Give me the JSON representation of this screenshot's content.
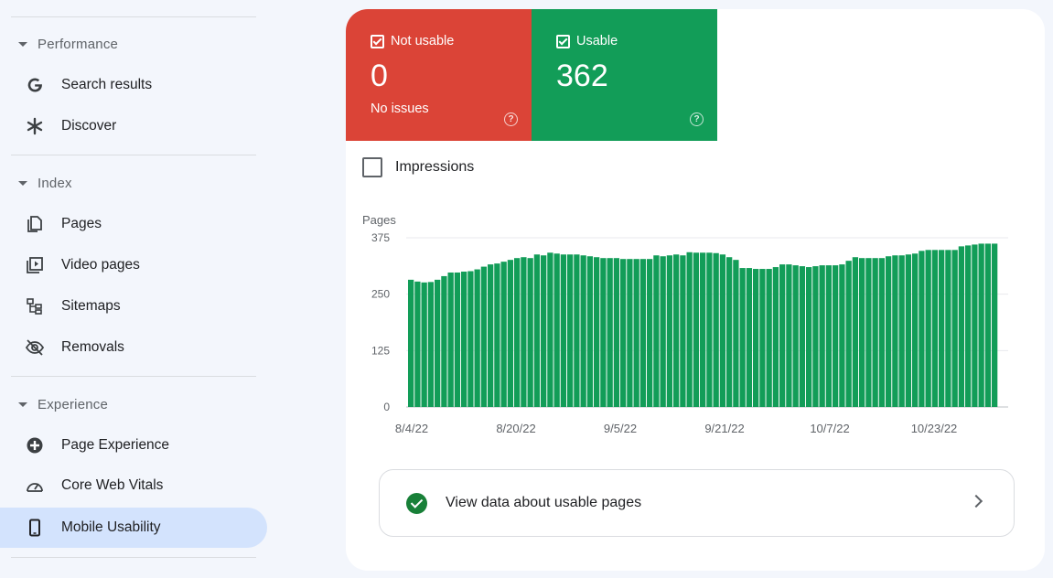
{
  "sidebar": {
    "sections": [
      {
        "title": "Performance",
        "items": [
          {
            "label": "Search results",
            "icon": "google-g-icon"
          },
          {
            "label": "Discover",
            "icon": "asterisk-icon"
          }
        ]
      },
      {
        "title": "Index",
        "items": [
          {
            "label": "Pages",
            "icon": "pages-icon"
          },
          {
            "label": "Video pages",
            "icon": "video-pages-icon"
          },
          {
            "label": "Sitemaps",
            "icon": "sitemap-icon"
          },
          {
            "label": "Removals",
            "icon": "eye-off-icon"
          }
        ]
      },
      {
        "title": "Experience",
        "items": [
          {
            "label": "Page Experience",
            "icon": "page-experience-icon"
          },
          {
            "label": "Core Web Vitals",
            "icon": "gauge-icon"
          },
          {
            "label": "Mobile Usability",
            "icon": "smartphone-icon",
            "active": true
          }
        ]
      }
    ]
  },
  "tiles": {
    "not_usable": {
      "label": "Not usable",
      "value": "0",
      "sub": "No issues",
      "color": "#db4437"
    },
    "usable": {
      "label": "Usable",
      "value": "362",
      "color": "#129d58"
    }
  },
  "impressions": {
    "label": "Impressions"
  },
  "chart_data": {
    "type": "bar",
    "ylabel": "Pages",
    "ylim": [
      0,
      375
    ],
    "yticks": [
      "375",
      "250",
      "125",
      "0"
    ],
    "xticks": [
      "8/4/22",
      "8/20/22",
      "9/5/22",
      "9/21/22",
      "10/7/22",
      "10/23/22"
    ],
    "color": "#129d58",
    "values": [
      282,
      278,
      276,
      277,
      282,
      290,
      298,
      298,
      300,
      301,
      305,
      311,
      316,
      318,
      322,
      326,
      330,
      332,
      330,
      338,
      336,
      342,
      340,
      338,
      338,
      338,
      336,
      334,
      332,
      330,
      330,
      330,
      328,
      328,
      328,
      328,
      328,
      336,
      334,
      336,
      338,
      336,
      343,
      342,
      342,
      342,
      341,
      338,
      332,
      326,
      308,
      308,
      306,
      306,
      306,
      310,
      316,
      316,
      314,
      312,
      310,
      312,
      314,
      314,
      314,
      316,
      324,
      332,
      330,
      330,
      330,
      330,
      334,
      336,
      336,
      338,
      340,
      346,
      348,
      348,
      348,
      348,
      348,
      356,
      358,
      360,
      362,
      362,
      362
    ]
  },
  "link": {
    "label": "View data about usable pages"
  }
}
